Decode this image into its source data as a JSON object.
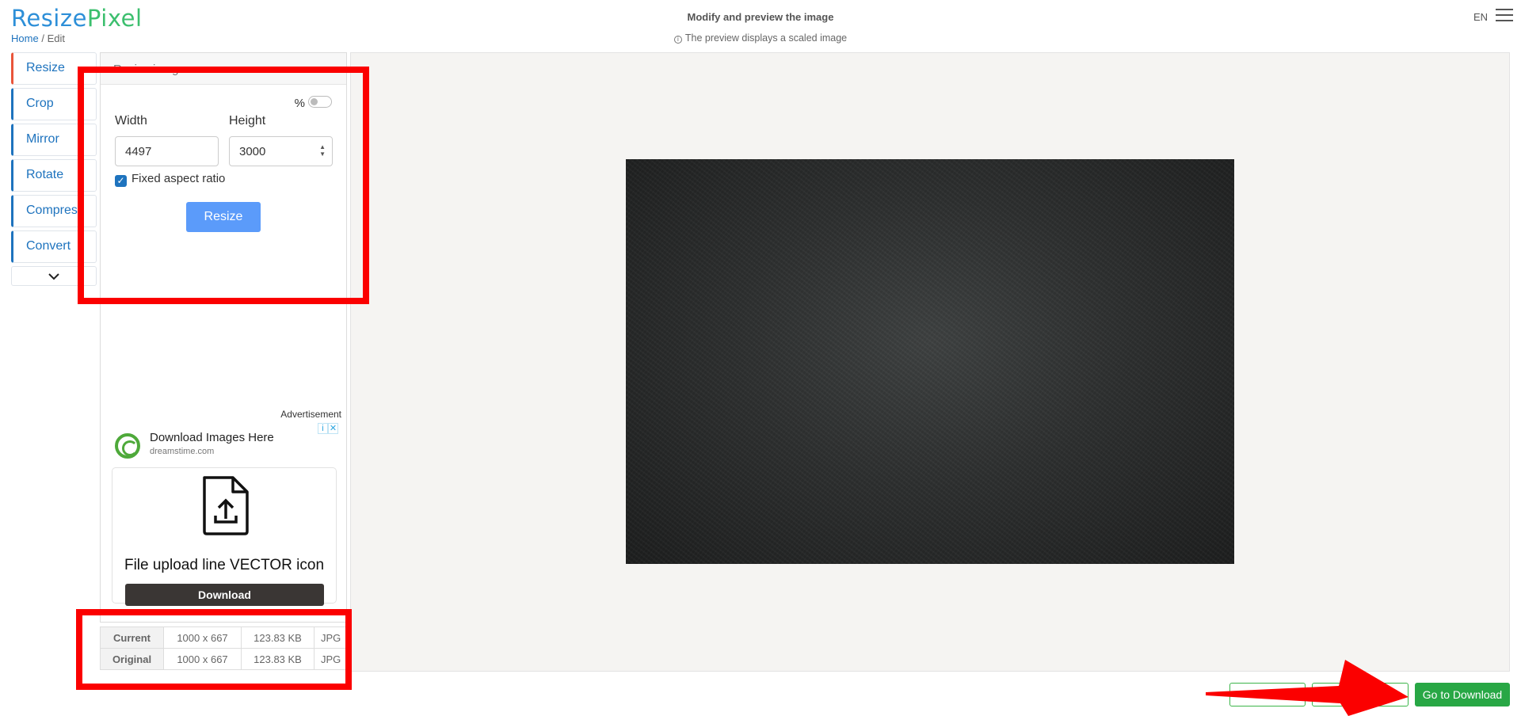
{
  "header": {
    "logo_part1": "Resize",
    "logo_part2": "Pixel",
    "breadcrumb_home": "Home",
    "breadcrumb_sep": "/",
    "breadcrumb_current": "Edit",
    "title": "Modify and preview the image",
    "subtitle": "The preview displays a scaled image",
    "language": "EN"
  },
  "nav": {
    "items": [
      {
        "label": "Resize",
        "active": true
      },
      {
        "label": "Crop"
      },
      {
        "label": "Mirror"
      },
      {
        "label": "Rotate"
      },
      {
        "label": "Compress"
      },
      {
        "label": "Convert"
      }
    ],
    "more_icon": "chevron-down-icon"
  },
  "panel": {
    "heading": "Resize image",
    "percent_label": "%",
    "width_label": "Width",
    "height_label": "Height",
    "width_value": "4497",
    "height_value": "3000",
    "fixed_ratio_label": "Fixed aspect ratio",
    "fixed_ratio_checked": true,
    "resize_button": "Resize"
  },
  "ad": {
    "label": "Advertisement",
    "title": "Download Images Here",
    "domain": "dreamstime.com",
    "card_title": "File upload line VECTOR icon",
    "download_button": "Download"
  },
  "info_table": {
    "rows": [
      {
        "label": "Current",
        "dimensions": "1000 x 667",
        "size": "123.83 KB",
        "format": "JPG"
      },
      {
        "label": "Original",
        "dimensions": "1000 x 667",
        "size": "123.83 KB",
        "format": "JPG"
      }
    ]
  },
  "actions": {
    "go_to_download": "Go to Download"
  },
  "colors": {
    "accent_blue": "#1e73be",
    "resize_button": "#5b9bfa",
    "download_green": "#28a745",
    "annotation_red": "#fb0000"
  }
}
